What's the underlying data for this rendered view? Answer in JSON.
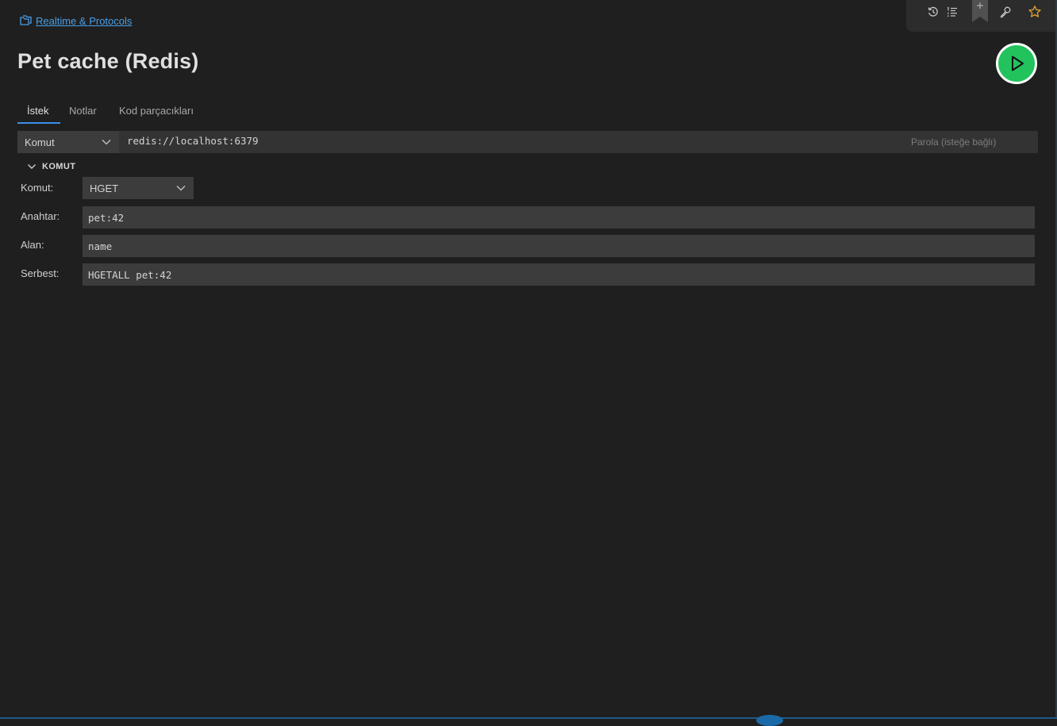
{
  "breadcrumb": {
    "icon": "folder-icon",
    "label": "Realtime & Protocols"
  },
  "toolbar": {
    "icons": [
      "history-icon",
      "list-icon",
      "bookmark-add-icon",
      "key-icon",
      "star-icon"
    ],
    "bookmark_plus": "+"
  },
  "page_title": "Pet cache (Redis)",
  "run_button": {
    "icon": "play-icon",
    "color": "#22c35d"
  },
  "tabs": [
    {
      "label": "İstek",
      "active": true
    },
    {
      "label": "Notlar",
      "active": false
    },
    {
      "label": "Kod parçacıkları",
      "active": false
    }
  ],
  "request": {
    "mode": "Komut",
    "url": "redis://localhost:6379",
    "password_placeholder": "Parola (isteğe bağlı)"
  },
  "section": {
    "title": "KOMUT",
    "command_label": "Komut:",
    "command_value": "HGET",
    "key_label": "Anahtar:",
    "key_value": "pet:42",
    "field_label": "Alan:",
    "field_value": "name",
    "raw_label": "Serbest:",
    "raw_value": "HGETALL pet:42"
  },
  "colors": {
    "background": "#1f1f1f",
    "accent": "#3b8eea",
    "link": "#4a9fe8",
    "run": "#22c35d",
    "star": "#e0a030"
  }
}
